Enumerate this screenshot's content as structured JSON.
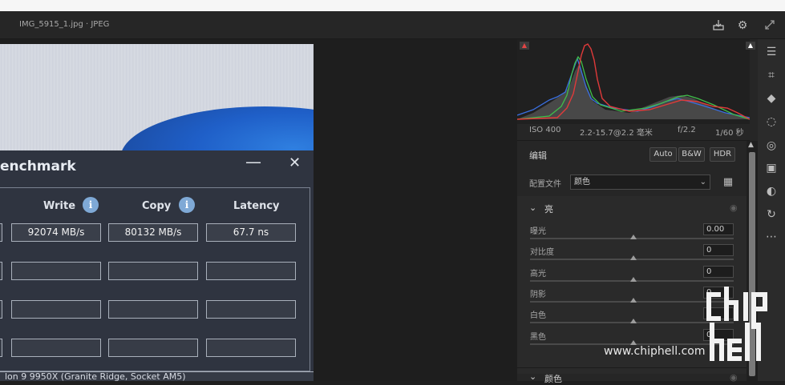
{
  "header": {
    "filename": "IMG_5915_1.jpg",
    "separator": " · ",
    "format": "JPEG"
  },
  "icons": {
    "download": "download-icon",
    "settings": "gear-icon",
    "expand": "expand-icon"
  },
  "photo": {
    "window_title": "enchmark",
    "columns": [
      {
        "label": "Write",
        "has_info": true
      },
      {
        "label": "Copy",
        "has_info": true
      },
      {
        "label": "Latency",
        "has_info": false
      }
    ],
    "values": {
      "write": "92074 MB/s",
      "copy": "80132 MB/s",
      "latency": "67.7 ns"
    },
    "cpu_line": "lon 9 9950X  (Granite Ridge, Socket AM5)"
  },
  "panel": {
    "exif": {
      "iso": "ISO 400",
      "lens": "2.2-15.7@2.2 毫米",
      "aperture": "f/2.2",
      "shutter": "1/60 秒"
    },
    "edit_label": "编辑",
    "mode_buttons": [
      "Auto",
      "B&W",
      "HDR"
    ],
    "profile_label": "配置文件",
    "profile_value": "颜色",
    "light_section": "亮",
    "sliders": [
      {
        "label": "曝光",
        "value": "0.00",
        "position": 0.5
      },
      {
        "label": "对比度",
        "value": "0",
        "position": 0.5
      },
      {
        "label": "高光",
        "value": "0",
        "position": 0.5
      },
      {
        "label": "阴影",
        "value": "0",
        "position": 0.5
      },
      {
        "label": "白色",
        "value": "0",
        "position": 0.5
      },
      {
        "label": "黑色",
        "value": "0",
        "position": 0.5
      }
    ],
    "color_section": "颜色"
  },
  "watermark": {
    "url": "www.chiphell.com",
    "logo": "chip hell"
  },
  "colors": {
    "histogram_red": "#e03a3a",
    "histogram_green": "#3fbf4a",
    "histogram_blue": "#3a6fe0"
  }
}
